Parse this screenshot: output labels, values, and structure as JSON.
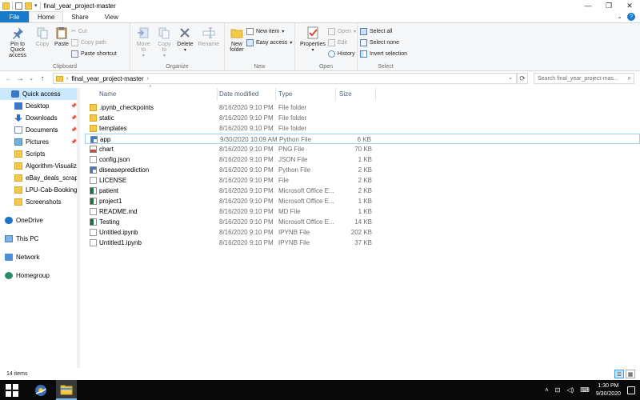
{
  "window": {
    "title": "final_year_project-master",
    "minimize": "—",
    "maximize": "❐",
    "close": "✕"
  },
  "ribbon": {
    "tabs": {
      "file": "File",
      "home": "Home",
      "share": "Share",
      "view": "View"
    },
    "help": "?",
    "groups": {
      "clipboard": {
        "label": "Clipboard",
        "pin": "Pin to Quick access",
        "copy": "Copy",
        "paste": "Paste",
        "cut": "Cut",
        "copy_path": "Copy path",
        "paste_shortcut": "Paste shortcut"
      },
      "organize": {
        "label": "Organize",
        "move_to": "Move to",
        "copy_to": "Copy to",
        "delete": "Delete",
        "rename": "Rename"
      },
      "new": {
        "label": "New",
        "new_folder": "New folder",
        "new_item": "New item",
        "easy_access": "Easy access"
      },
      "open": {
        "label": "Open",
        "properties": "Properties",
        "open": "Open",
        "edit": "Edit",
        "history": "History"
      },
      "select": {
        "label": "Select",
        "select_all": "Select all",
        "select_none": "Select none",
        "invert": "Invert selection"
      }
    }
  },
  "address": {
    "path": "final_year_project-master",
    "search_placeholder": "Search final_year_project-mas..."
  },
  "navpane": {
    "items": [
      {
        "label": "Quick access",
        "icon": "star",
        "selected": true
      },
      {
        "label": "Desktop",
        "icon": "desktop",
        "pinned": true
      },
      {
        "label": "Downloads",
        "icon": "download",
        "pinned": true
      },
      {
        "label": "Documents",
        "icon": "documents",
        "pinned": true
      },
      {
        "label": "Pictures",
        "icon": "pictures",
        "pinned": true
      },
      {
        "label": "Scripts",
        "icon": "folder"
      },
      {
        "label": "Algorithm-Visualiza",
        "icon": "folder"
      },
      {
        "label": "eBay_deals_scraper-",
        "icon": "folder"
      },
      {
        "label": "LPU-Cab-Booking-S",
        "icon": "folder"
      },
      {
        "label": "Screenshots",
        "icon": "folder"
      },
      {
        "label": "OneDrive",
        "icon": "cloud"
      },
      {
        "label": "This PC",
        "icon": "pc"
      },
      {
        "label": "Network",
        "icon": "network"
      },
      {
        "label": "Homegroup",
        "icon": "homegroup"
      }
    ]
  },
  "columns": {
    "name": "Name",
    "date": "Date modified",
    "type": "Type",
    "size": "Size"
  },
  "files": [
    {
      "name": ".ipynb_checkpoints",
      "date": "8/16/2020 9:10 PM",
      "type": "File folder",
      "size": "",
      "icon": "folder"
    },
    {
      "name": "static",
      "date": "8/16/2020 9:10 PM",
      "type": "File folder",
      "size": "",
      "icon": "folder"
    },
    {
      "name": "templates",
      "date": "8/16/2020 9:10 PM",
      "type": "File folder",
      "size": "",
      "icon": "folder"
    },
    {
      "name": "app",
      "date": "9/30/2020 10:09 AM",
      "type": "Python File",
      "size": "6 KB",
      "icon": "python"
    },
    {
      "name": "chart",
      "date": "8/16/2020 9:10 PM",
      "type": "PNG File",
      "size": "70 KB",
      "icon": "image"
    },
    {
      "name": "config.json",
      "date": "8/16/2020 9:10 PM",
      "type": "JSON File",
      "size": "1 KB",
      "icon": "file"
    },
    {
      "name": "diseaseprediction",
      "date": "8/16/2020 9:10 PM",
      "type": "Python File",
      "size": "2 KB",
      "icon": "python"
    },
    {
      "name": "LICENSE",
      "date": "8/16/2020 9:10 PM",
      "type": "File",
      "size": "2 KB",
      "icon": "file"
    },
    {
      "name": "patient",
      "date": "8/16/2020 9:10 PM",
      "type": "Microsoft Office E...",
      "size": "2 KB",
      "icon": "excel"
    },
    {
      "name": "project1",
      "date": "8/16/2020 9:10 PM",
      "type": "Microsoft Office E...",
      "size": "1 KB",
      "icon": "excel"
    },
    {
      "name": "README.md",
      "date": "8/16/2020 9:10 PM",
      "type": "MD File",
      "size": "1 KB",
      "icon": "file"
    },
    {
      "name": "Testing",
      "date": "8/16/2020 9:10 PM",
      "type": "Microsoft Office E...",
      "size": "14 KB",
      "icon": "excel"
    },
    {
      "name": "Untitled.ipynb",
      "date": "8/16/2020 9:10 PM",
      "type": "IPYNB File",
      "size": "202 KB",
      "icon": "file"
    },
    {
      "name": "Untitled1.ipynb",
      "date": "8/16/2020 9:10 PM",
      "type": "IPYNB File",
      "size": "37 KB",
      "icon": "file"
    }
  ],
  "focused_index": 3,
  "status": {
    "count": "14 items"
  },
  "taskbar": {
    "time": "1:30 PM",
    "date": "9/30/2020"
  },
  "colors": {
    "accent": "#1979ca",
    "folder": "#f2c94c",
    "selection": "#cce8ff"
  }
}
